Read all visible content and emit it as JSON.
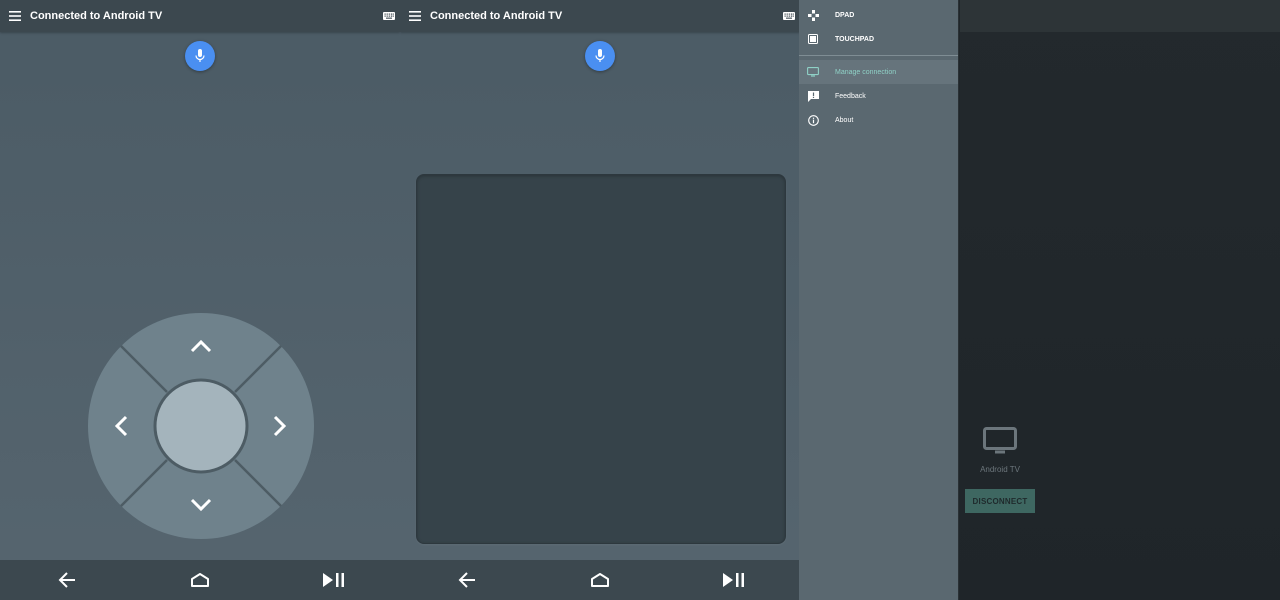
{
  "remote_dpad": {
    "title": "Connected to Android TV",
    "icons": {
      "menu": "menu-icon",
      "keyboard": "keyboard-icon",
      "mic": "mic-icon",
      "back": "back-arrow-icon",
      "home": "home-icon",
      "play_pause": "play-pause-icon"
    }
  },
  "remote_touchpad": {
    "title": "Connected to Android TV"
  },
  "drawer": {
    "items": [
      {
        "label": "DPAD",
        "icon": "gamepad-icon"
      },
      {
        "label": "TOUCHPAD",
        "icon": "touchpad-icon"
      },
      {
        "label": "Manage connection",
        "icon": "tv-icon",
        "selected": true
      },
      {
        "label": "Feedback",
        "icon": "feedback-icon"
      },
      {
        "label": "About",
        "icon": "info-icon"
      }
    ]
  },
  "connection": {
    "device_name": "Android TV",
    "disconnect_label": "DISCONNECT"
  },
  "colors": {
    "accent_mic": "#4a8ff1",
    "selected_text": "#8fd1c6",
    "disconnect_bg": "#3e6761"
  }
}
